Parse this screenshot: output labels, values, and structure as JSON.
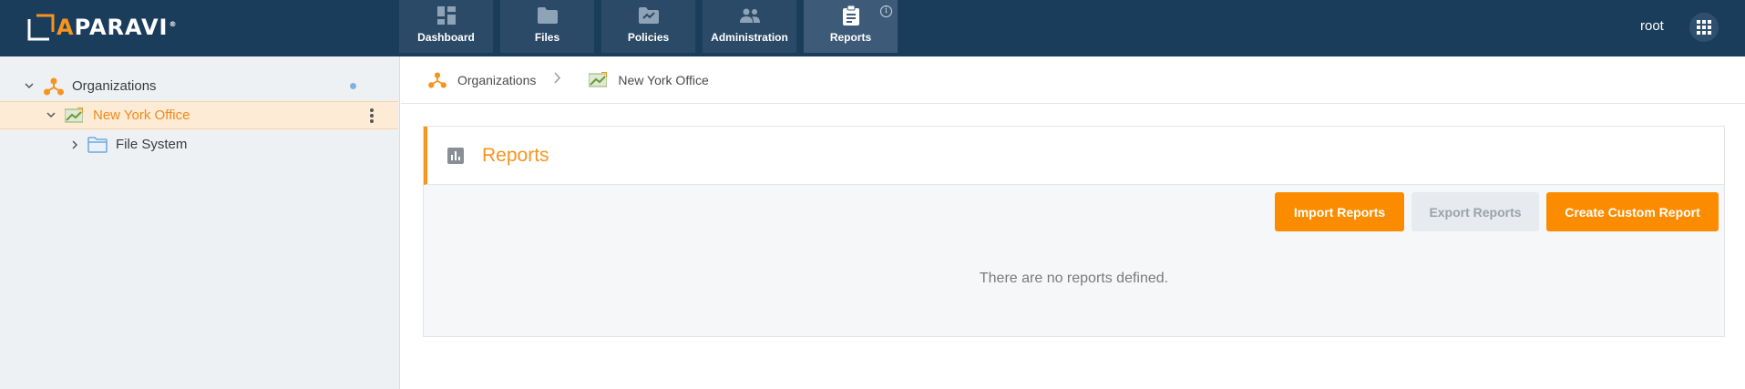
{
  "brand": {
    "name_prefix": "",
    "name_a": "A",
    "name_rest": "PARAVI",
    "reg": "®",
    "accent": "#f7941d",
    "bar_color": "#1b3d5c"
  },
  "nav": {
    "items": [
      {
        "label": "Dashboard",
        "icon": "dashboard-icon"
      },
      {
        "label": "Files",
        "icon": "folder-icon"
      },
      {
        "label": "Policies",
        "icon": "policy-folder-icon"
      },
      {
        "label": "Administration",
        "icon": "users-icon"
      },
      {
        "label": "Reports",
        "icon": "clipboard-icon",
        "active": true,
        "info": "i"
      }
    ]
  },
  "user": {
    "name": "root",
    "apps_icon": "grid-icon"
  },
  "tree": {
    "items": [
      {
        "label": "Organizations",
        "icon": "organization-icon",
        "expanded": true
      },
      {
        "label": "New York Office",
        "icon": "location-icon",
        "expanded": true,
        "selected": true
      },
      {
        "label": "File System",
        "icon": "folder-icon",
        "expanded": false
      }
    ]
  },
  "breadcrumb": {
    "items": [
      {
        "label": "Organizations",
        "icon": "organization-icon"
      },
      {
        "label": "New York Office",
        "icon": "location-icon"
      }
    ]
  },
  "reports": {
    "title": "Reports",
    "title_icon": "bar-chart-icon",
    "import_label": "Import Reports",
    "export_label": "Export Reports",
    "create_label": "Create Custom Report",
    "empty_message": "There are no reports defined."
  }
}
